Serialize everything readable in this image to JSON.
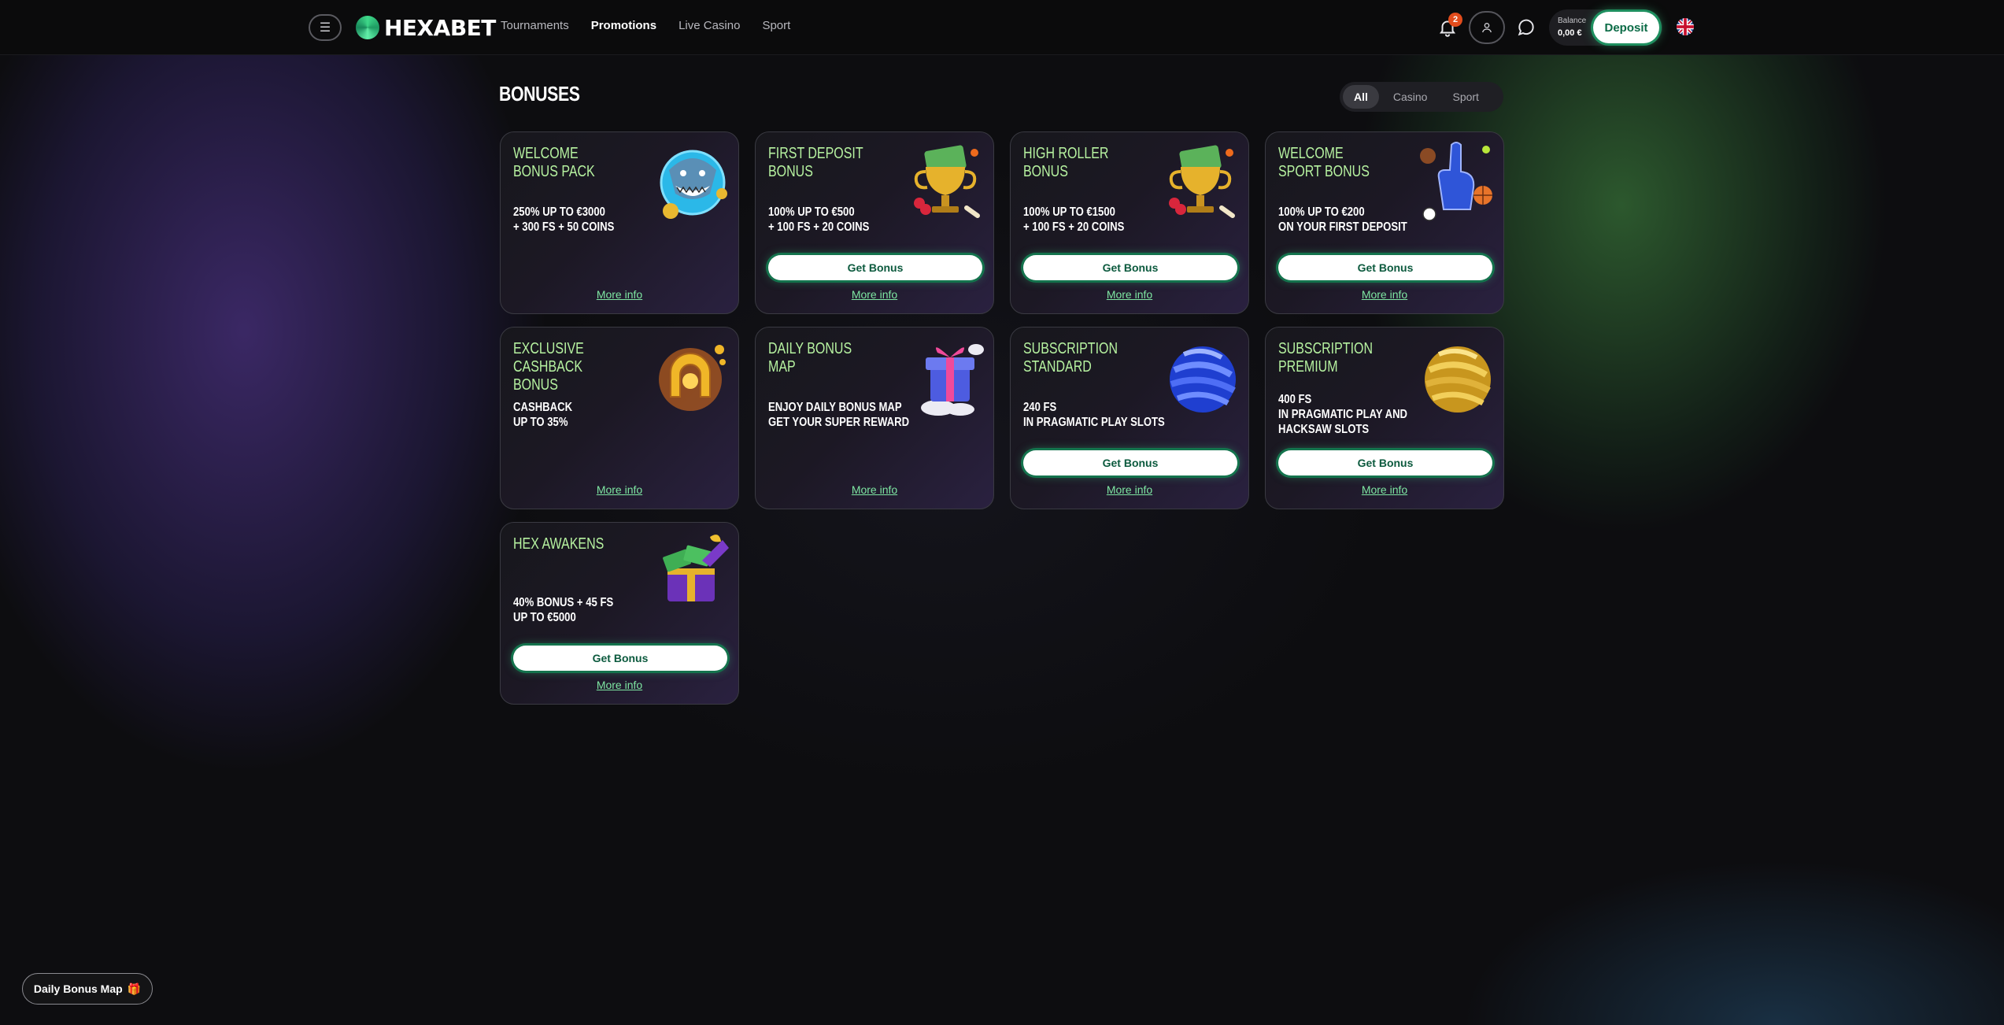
{
  "header": {
    "logo_text": "HEXABET",
    "nav": [
      {
        "label": "Tournaments",
        "active": false
      },
      {
        "label": "Promotions",
        "active": true
      },
      {
        "label": "Live Casino",
        "active": false
      },
      {
        "label": "Sport",
        "active": false
      }
    ],
    "notifications_count": "2",
    "balance_label": "Balance",
    "balance_value": "0,00 €",
    "deposit_label": "Deposit",
    "language_flag": "uk-flag-icon"
  },
  "main": {
    "title": "BONUSES",
    "filters": [
      {
        "label": "All",
        "active": true
      },
      {
        "label": "Casino",
        "active": false
      },
      {
        "label": "Sport",
        "active": false
      }
    ],
    "get_bonus_label": "Get Bonus",
    "more_info_label": "More info",
    "cards": [
      {
        "title": "WELCOME BONUS PACK",
        "desc": "250% UP TO €3000\n+ 300 FS + 50 COINS",
        "icon": "shark-icon",
        "has_button": false
      },
      {
        "title": "FIRST DEPOSIT BONUS",
        "desc": "100% UP TO €500\n+ 100 FS + 20 COINS",
        "icon": "trophy-icon",
        "has_button": true
      },
      {
        "title": "HIGH ROLLER BONUS",
        "desc": "100% UP TO €1500\n+ 100 FS + 20 COINS",
        "icon": "trophy-icon",
        "has_button": true
      },
      {
        "title": "WELCOME SPORT BONUS",
        "desc": "100% UP TO €200\nON YOUR FIRST DEPOSIT",
        "icon": "foam-finger-icon",
        "has_button": true
      },
      {
        "title": "EXCLUSIVE CASHBACK\nBONUS",
        "desc": "CASHBACK\nUP TO 35%",
        "icon": "horseshoe-icon",
        "has_button": false
      },
      {
        "title": "DAILY BONUS MAP",
        "desc": "ENJOY DAILY BONUS MAP\nGET YOUR SUPER REWARD",
        "icon": "gift-box-icon",
        "has_button": false
      },
      {
        "title": "SUBSCRIPTION STANDARD",
        "desc": "240 FS\nIN PRAGMATIC PLAY SLOTS",
        "icon": "blue-orb-icon",
        "has_button": true
      },
      {
        "title": "SUBSCRIPTION PREMIUM",
        "desc": "400 FS\nIN PRAGMATIC PLAY AND\nHACKSAW SLOTS",
        "icon": "gold-orb-icon",
        "has_button": true
      },
      {
        "title": "HEX AWAKENS",
        "desc": "40% BONUS + 45 FS\nUP TO €5000",
        "icon": "money-chest-icon",
        "has_button": true
      }
    ]
  },
  "floating": {
    "daily_bonus_label": "Daily Bonus Map",
    "daily_bonus_emoji": "🎁"
  }
}
